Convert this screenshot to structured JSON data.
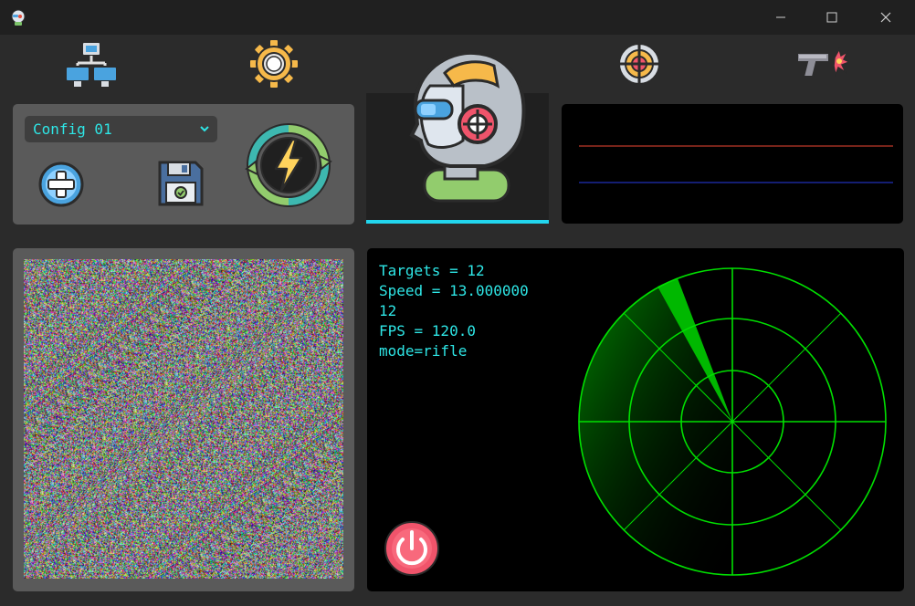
{
  "window": {
    "controls": [
      "minimize",
      "maximize",
      "close"
    ]
  },
  "nav": {
    "tabs": [
      {
        "name": "network",
        "icon": "network-icon"
      },
      {
        "name": "settings",
        "icon": "gear-icon"
      },
      {
        "name": "aim",
        "icon": "robot-head-icon",
        "active": true
      },
      {
        "name": "crosshair",
        "icon": "crosshair-icon"
      },
      {
        "name": "weapon",
        "icon": "pistol-icon"
      }
    ]
  },
  "config": {
    "selected": "Config 01",
    "add_icon": "plus-circle-icon",
    "save_icon": "floppy-disk-icon",
    "activate_icon": "power-refresh-icon"
  },
  "graph": {
    "lines": [
      {
        "color": "#c0392b"
      },
      {
        "color": "#2130b8"
      }
    ]
  },
  "stats": {
    "line1": "Targets = 12",
    "line2": "Speed = 13.000000",
    "line3": "12",
    "line4": "FPS = 120.0",
    "line5": "mode=rifle"
  },
  "colors": {
    "accent": "#22d6ee",
    "radar": "#00e000",
    "power": "#f0546b"
  }
}
